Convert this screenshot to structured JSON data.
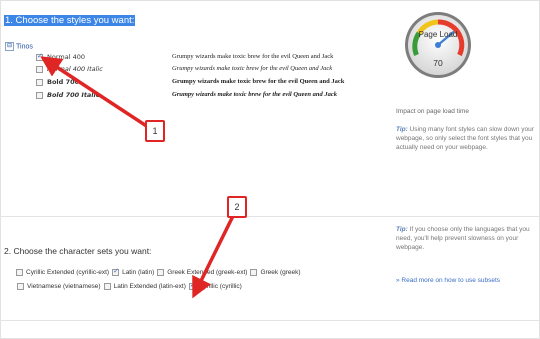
{
  "step1": {
    "title": "1. Choose the styles you want:"
  },
  "family": {
    "toggle": "⊟",
    "name": "Tinos"
  },
  "styles": [
    {
      "name": "Normal 400",
      "checked": true,
      "sample": "Grumpy wizards make toxic brew for the evil Queen and Jack"
    },
    {
      "name": "Normal 400 Italic",
      "checked": false,
      "sample": "Grumpy wizards make toxic brew for the evil Queen and Jack"
    },
    {
      "name": "Bold 700",
      "checked": false,
      "sample": "Grumpy wizards make toxic brew for the evil Queen and Jack"
    },
    {
      "name": "Bold 700 Italic",
      "checked": false,
      "sample": "Grumpy wizards make toxic brew for the evil Queen and Jack"
    }
  ],
  "gauge": {
    "label": "Page Load",
    "value": "70",
    "level": 70
  },
  "impact": {
    "label": "Impact on page load time"
  },
  "tip1": {
    "prefix": "Tip:",
    "text": " Using many font styles can slow down your webpage, so only select the font styles that you actually need on your webpage."
  },
  "step2": {
    "title": "2. Choose the character sets you want:"
  },
  "subsets_row1": [
    {
      "label": "Cyrillic Extended (cyrillic-ext)",
      "checked": false
    },
    {
      "label": "Latin (latin)",
      "checked": true
    },
    {
      "label": "Greek Extended (greek-ext)",
      "checked": false
    },
    {
      "label": "Greek (greek)",
      "checked": false
    }
  ],
  "subsets_row2": [
    {
      "label": "Vietnamese (vietnamese)",
      "checked": false
    },
    {
      "label": "Latin Extended (latin-ext)",
      "checked": false
    },
    {
      "label": "Cyrillic (cyrillic)",
      "checked": true
    }
  ],
  "tip2": {
    "prefix": "Tip:",
    "text": " If you choose only the languages that you need, you'll help prevent slowness on your webpage."
  },
  "subsets_link": {
    "text": "» Read more on how to use subsets"
  },
  "annotations": {
    "badge1": "1",
    "badge2": "2"
  },
  "colors": {
    "accent": "#3b86e6",
    "annotation": "#e02525",
    "link": "#3b6fc4"
  }
}
